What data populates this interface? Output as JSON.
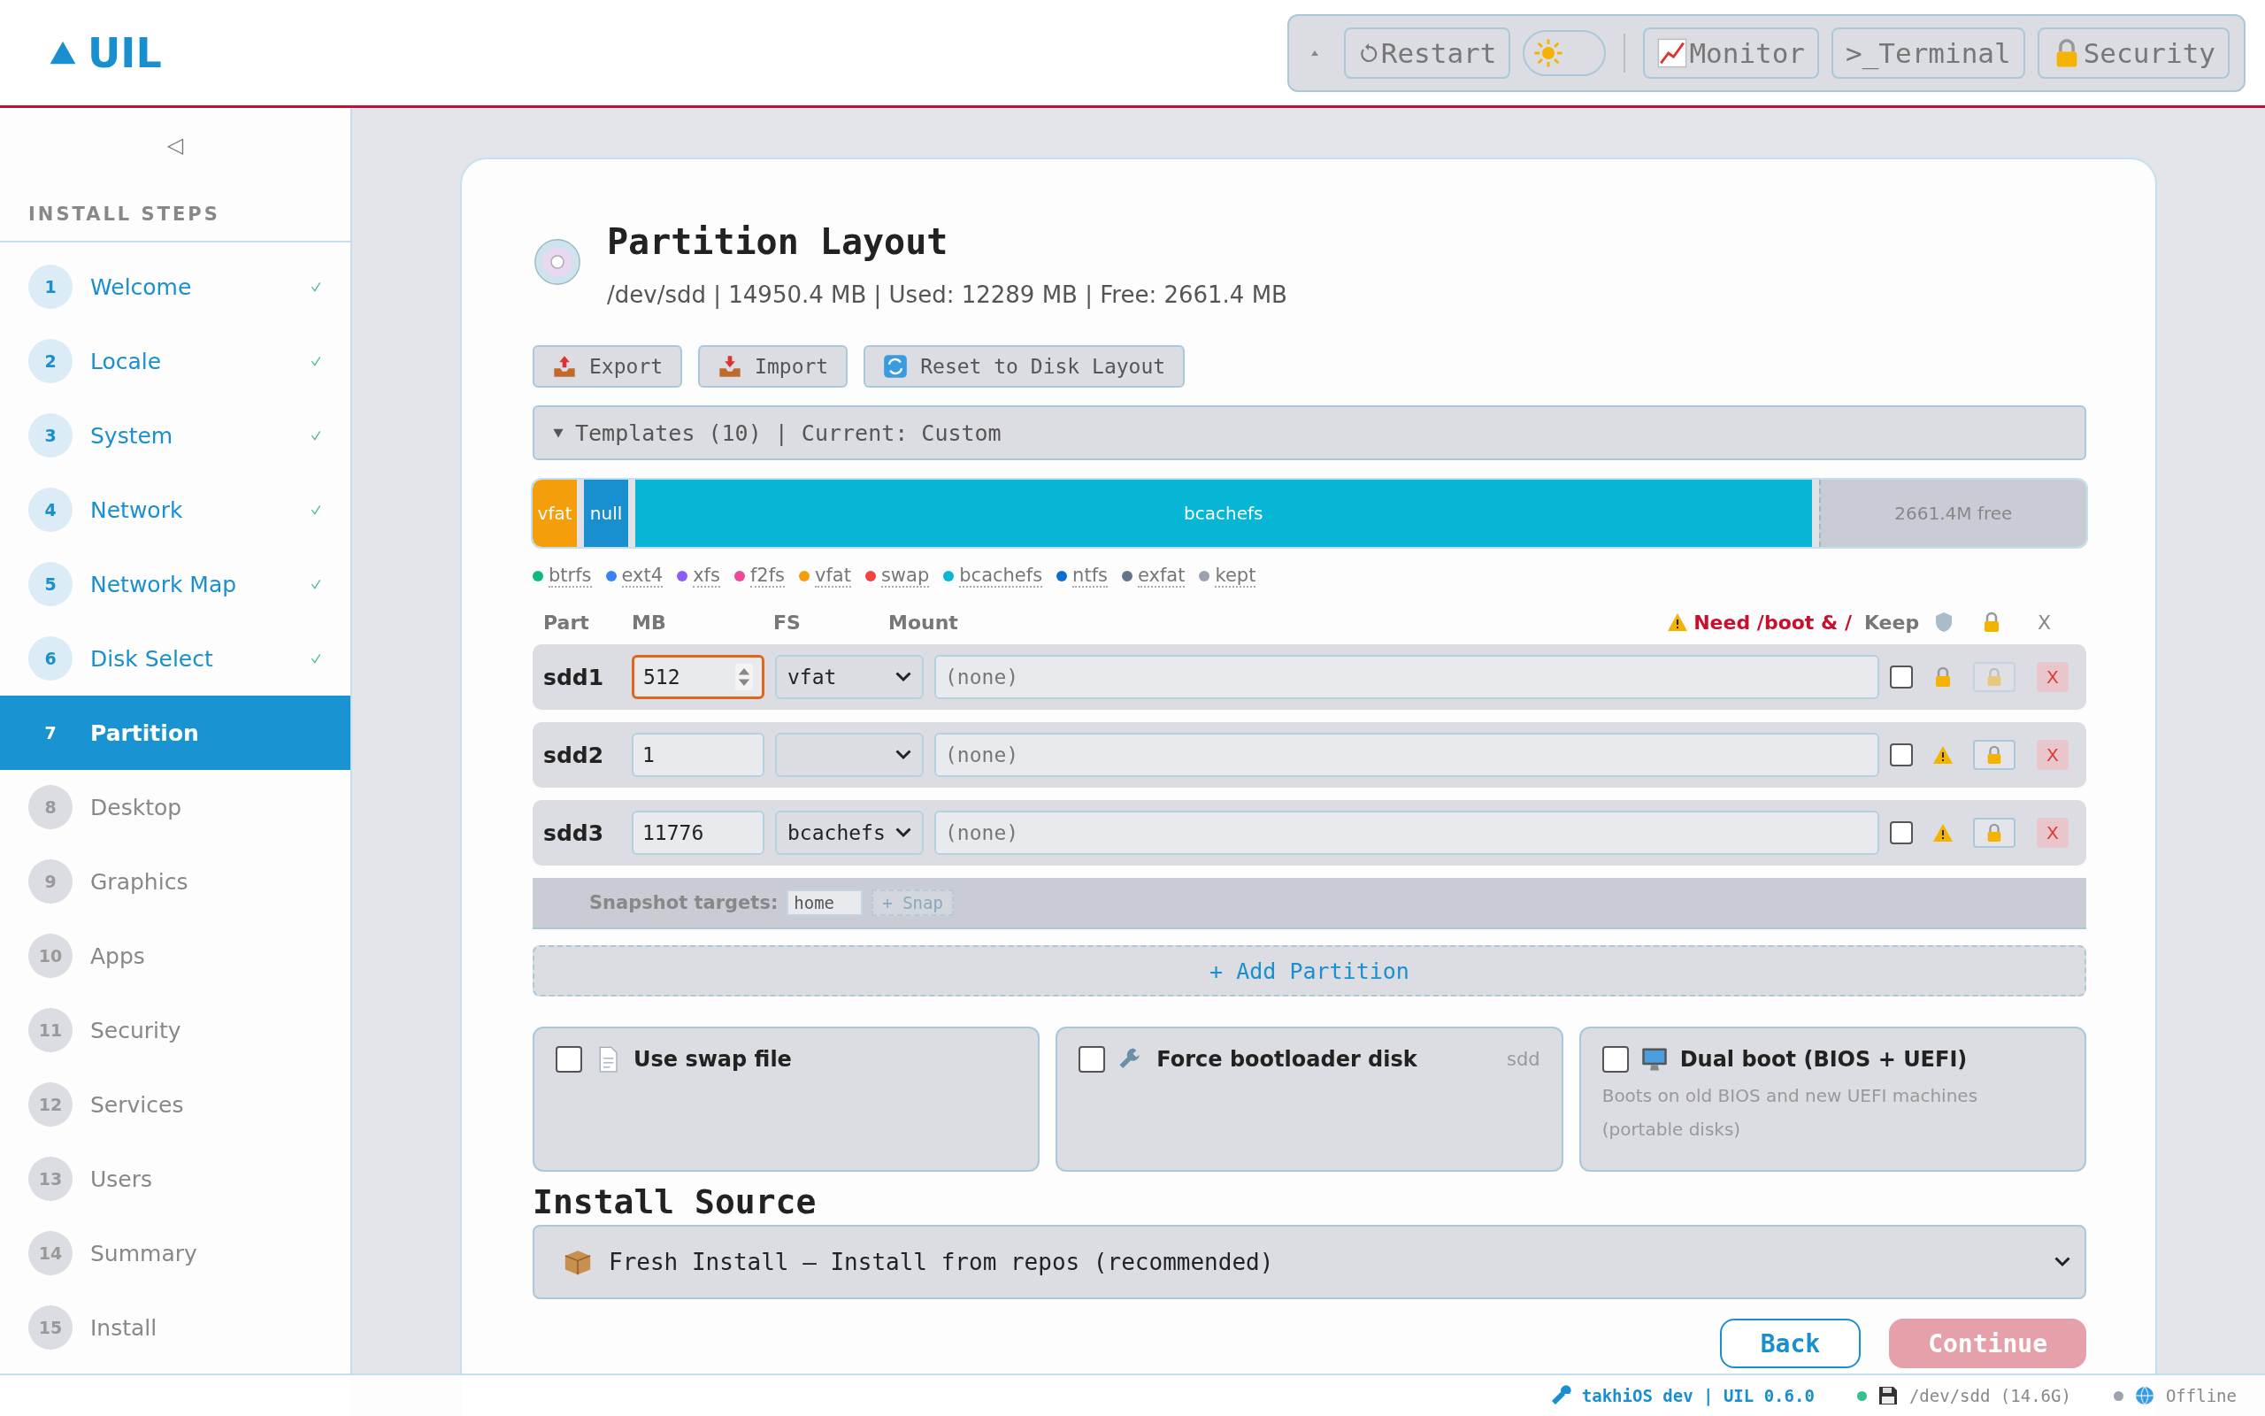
{
  "brand": {
    "name": "UIL"
  },
  "toolbar": {
    "buttons": [
      {
        "kind": "restart",
        "label": "Restart"
      },
      {
        "kind": "theme",
        "dark": false
      },
      {
        "kind": "monitor",
        "label": "Monitor"
      },
      {
        "kind": "terminal",
        "label": ">_Terminal"
      },
      {
        "kind": "security",
        "label": "Security"
      }
    ]
  },
  "sidebar": {
    "collapse": "◁",
    "heading": "INSTALL STEPS",
    "steps": [
      {
        "number": "1",
        "label": "Welcome",
        "done": true,
        "selected": false
      },
      {
        "number": "2",
        "label": "Locale",
        "done": true,
        "selected": false
      },
      {
        "number": "3",
        "label": "System",
        "done": true,
        "selected": false
      },
      {
        "number": "4",
        "label": "Network",
        "done": true,
        "selected": false
      },
      {
        "number": "5",
        "label": "Network Map",
        "done": true,
        "selected": false
      },
      {
        "number": "6",
        "label": "Disk Select",
        "done": true,
        "selected": false
      },
      {
        "number": "7",
        "label": "Partition",
        "done": false,
        "selected": true
      },
      {
        "number": "8",
        "label": "Desktop",
        "done": false,
        "selected": false
      },
      {
        "number": "9",
        "label": "Graphics",
        "done": false,
        "selected": false
      },
      {
        "number": "10",
        "label": "Apps",
        "done": false,
        "selected": false
      },
      {
        "number": "11",
        "label": "Security",
        "done": false,
        "selected": false
      },
      {
        "number": "12",
        "label": "Services",
        "done": false,
        "selected": false
      },
      {
        "number": "13",
        "label": "Users",
        "done": false,
        "selected": false
      },
      {
        "number": "14",
        "label": "Summary",
        "done": false,
        "selected": false
      },
      {
        "number": "15",
        "label": "Install",
        "done": false,
        "selected": false
      }
    ]
  },
  "page": {
    "title": "Partition Layout",
    "subtitle": "/dev/sdd | 14950.4 MB | Used: 12289 MB | Free: 2661.4 MB",
    "actions": [
      {
        "kind": "export",
        "label": "Export"
      },
      {
        "kind": "import",
        "label": "Import"
      },
      {
        "kind": "reset",
        "label": "Reset to Disk Layout"
      }
    ],
    "templates": {
      "label": "Templates (10) | Current: Custom",
      "expanded": false
    },
    "disk_bar": [
      {
        "kind": "part",
        "label": "vfat",
        "color": "#f59e0b"
      },
      {
        "kind": "part",
        "label": "null",
        "color": "#1a8fd0"
      },
      {
        "kind": "part",
        "label": "bcachefs",
        "color": "#06b6d4"
      },
      {
        "kind": "free",
        "label": "2661.4M free",
        "color": "#c9ccd4"
      }
    ],
    "legend": [
      {
        "label": "btrfs",
        "color": "#10b981"
      },
      {
        "label": "ext4",
        "color": "#3b82f6"
      },
      {
        "label": "xfs",
        "color": "#8b5cf6"
      },
      {
        "label": "f2fs",
        "color": "#ec4899"
      },
      {
        "label": "vfat",
        "color": "#f59e0b"
      },
      {
        "label": "swap",
        "color": "#ef4444"
      },
      {
        "label": "bcachefs",
        "color": "#06b6d4"
      },
      {
        "label": "ntfs",
        "color": "#0a6fd0"
      },
      {
        "label": "exfat",
        "color": "#64748b"
      },
      {
        "label": "kept",
        "color": "#9ca3af"
      }
    ],
    "table": {
      "columns": [
        "Part",
        "MB",
        "FS",
        "Mount"
      ],
      "warning": "Need /boot & /",
      "keep": "Keep",
      "remove": "X",
      "rows": [
        {
          "name": "sdd1",
          "size": "512",
          "focused": true,
          "fs": "vfat",
          "mount_placeholder": "(none)",
          "keep": false,
          "kind": "lock",
          "lock_disabled": true,
          "remove": "X"
        },
        {
          "name": "sdd2",
          "size": "1",
          "focused": false,
          "fs": "",
          "mount_placeholder": "(none)",
          "keep": false,
          "kind": "warning",
          "lock_disabled": false,
          "remove": "X"
        },
        {
          "name": "sdd3",
          "size": "11776",
          "focused": false,
          "fs": "bcachefs",
          "mount_placeholder": "(none)",
          "keep": false,
          "kind": "warning",
          "lock_disabled": false,
          "remove": "X"
        }
      ]
    },
    "snapshot": {
      "label": "Snapshot targets:",
      "value": "home",
      "button": "+ Snap"
    },
    "add_button": "+ Add Partition",
    "options": [
      {
        "kind": "doc",
        "label": "Use swap file",
        "checked": false
      },
      {
        "kind": "wrench",
        "label": "Force bootloader disk",
        "note": "sdd",
        "checked": false
      },
      {
        "kind": "monitor",
        "label": "Dual boot (BIOS + UEFI)",
        "description": [
          "Boots on old BIOS and new UEFI machines",
          "(portable disks)"
        ],
        "checked": false
      }
    ],
    "install_source": {
      "heading": "Install Source",
      "value": "Fresh Install — Install from repos (recommended)"
    },
    "nav": [
      {
        "kind": "back",
        "label": "Back",
        "disabled": false
      },
      {
        "kind": "continue",
        "label": "Continue",
        "disabled": true
      }
    ]
  },
  "status_bar": {
    "build": "takhiOS dev | UIL 0.6.0",
    "items": [
      {
        "kind": "disk",
        "text": "/dev/sdd (14.6G)",
        "color": "#34c08a"
      },
      {
        "kind": "network",
        "text": "Offline",
        "color": "#9ca3af"
      }
    ]
  }
}
